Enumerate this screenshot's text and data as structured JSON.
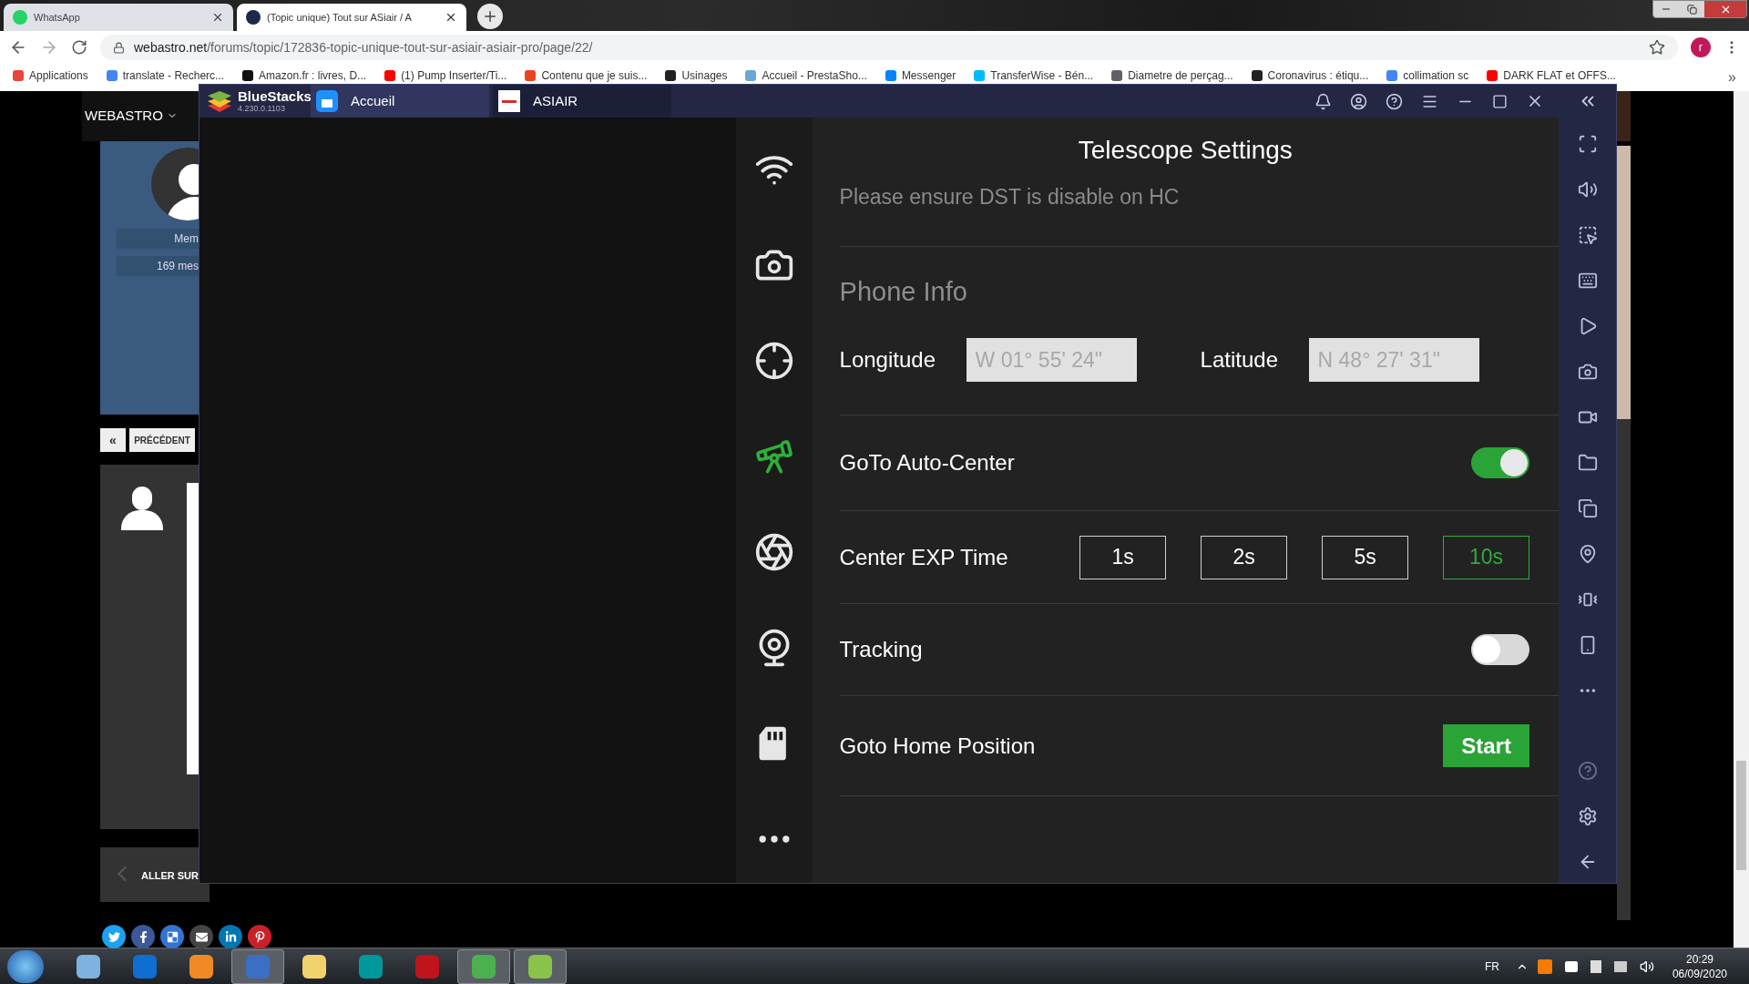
{
  "browser": {
    "tabs": [
      {
        "title": "WhatsApp",
        "selected": false
      },
      {
        "title": "(Topic unique) Tout sur ASiair / A",
        "selected": true
      }
    ],
    "url": {
      "host": "webastro.net",
      "path": "/forums/topic/172836-topic-unique-tout-sur-asiair-asiair-pro/page/22/"
    },
    "profile_initial": "r",
    "bookmarks": [
      {
        "label": "Applications",
        "color": "#e8453c"
      },
      {
        "label": "translate - Recherc...",
        "color": "#4285f4"
      },
      {
        "label": "Amazon.fr : livres, D...",
        "color": "#111111"
      },
      {
        "label": "(1) Pump Inserter/Ti...",
        "color": "#ff0000"
      },
      {
        "label": "Contenu que je suis...",
        "color": "#e8451e"
      },
      {
        "label": "Usinages",
        "color": "#222222"
      },
      {
        "label": "Accueil - PrestaSho...",
        "color": "#6aa7d8"
      },
      {
        "label": "Messenger",
        "color": "#0084ff"
      },
      {
        "label": "TransferWise - Bén...",
        "color": "#00b9ff"
      },
      {
        "label": "Diametre de perçag...",
        "color": "#5f6368"
      },
      {
        "label": "Coronavirus : étiqu...",
        "color": "#222222"
      },
      {
        "label": "collimation sc",
        "color": "#4285f4"
      },
      {
        "label": "DARK FLAT et OFFS...",
        "color": "#ff0000"
      }
    ],
    "bookmarks_more": "»"
  },
  "webpage": {
    "nav": "WEBASTRO",
    "profile_lines": [
      "Mem",
      "169 mes"
    ],
    "pagination": [
      "«",
      "PRÉCÉDENT"
    ],
    "footer": "ALLER SUR"
  },
  "bluestacks": {
    "name": "BlueStacks",
    "version": "4.230.0.1103",
    "tabs": [
      {
        "label": "Accueil",
        "selected": true
      },
      {
        "label": "ASIAIR",
        "selected": false
      }
    ],
    "nav": [
      {
        "kind": "wifi",
        "selected": false
      },
      {
        "kind": "camera",
        "selected": false
      },
      {
        "kind": "crosshair",
        "selected": false
      },
      {
        "kind": "telescope",
        "selected": true
      },
      {
        "kind": "aperture",
        "selected": false
      },
      {
        "kind": "webcam",
        "selected": false
      },
      {
        "kind": "card",
        "selected": false
      },
      {
        "kind": "more",
        "selected": false
      }
    ],
    "settings": {
      "title": "Telescope Settings",
      "note": "Please ensure DST is disable on HC",
      "section": "Phone Info",
      "longitude": {
        "label": "Longitude",
        "value": "W 01° 55' 24\""
      },
      "latitude": {
        "label": "Latitude",
        "value": "N 48° 27' 31\""
      },
      "auto_center": {
        "label": "GoTo Auto-Center",
        "on": true
      },
      "exp_time": {
        "label": "Center EXP Time",
        "options": [
          {
            "label": "1s",
            "selected": false
          },
          {
            "label": "2s",
            "selected": false
          },
          {
            "label": "5s",
            "selected": false
          },
          {
            "label": "10s",
            "selected": true
          }
        ]
      },
      "tracking": {
        "label": "Tracking",
        "on": false
      },
      "home": {
        "label": "Goto Home Position",
        "button": "Start"
      }
    }
  },
  "taskbar": {
    "apps": [
      {
        "color": "#7fb2e0",
        "active": false
      },
      {
        "color": "#0e6ed1",
        "active": false
      },
      {
        "color": "#f08a24",
        "active": false
      },
      {
        "color": "#3b6fc4",
        "active": true
      },
      {
        "color": "#f2d26b",
        "active": false
      },
      {
        "color": "#00979d",
        "active": false
      },
      {
        "color": "#c0141d",
        "active": false
      },
      {
        "color": "#4caf50",
        "active": true
      },
      {
        "color": "#8bc34a",
        "active": true
      }
    ],
    "language": "FR",
    "time": "20:29",
    "date": "06/09/2020"
  }
}
